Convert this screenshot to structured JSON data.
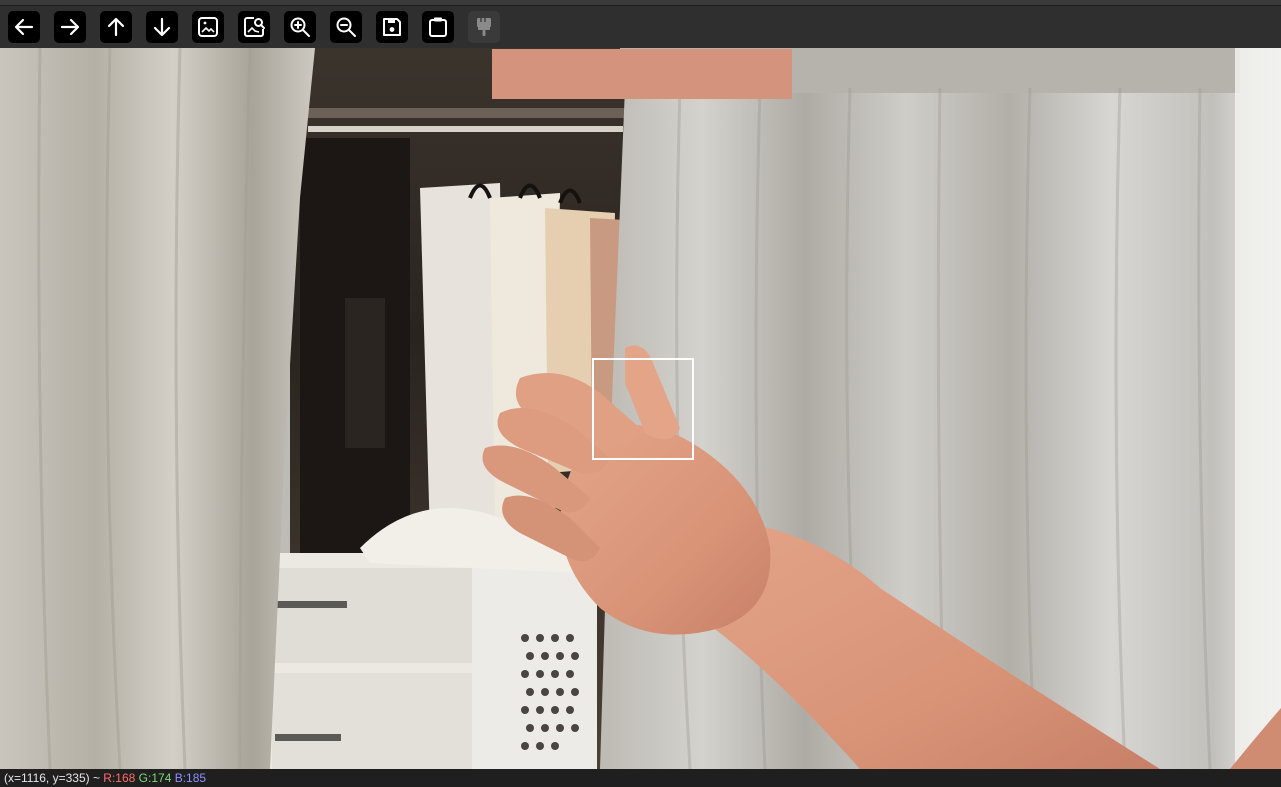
{
  "toolbar": {
    "buttons": [
      {
        "name": "pan-left",
        "icon": "arrow-left-icon",
        "enabled": true
      },
      {
        "name": "pan-right",
        "icon": "arrow-right-icon",
        "enabled": true
      },
      {
        "name": "pan-up",
        "icon": "arrow-up-icon",
        "enabled": true
      },
      {
        "name": "pan-down",
        "icon": "arrow-down-icon",
        "enabled": true
      },
      {
        "name": "zoom-to-fit",
        "icon": "image-icon",
        "enabled": true
      },
      {
        "name": "zoom-original",
        "icon": "image-search-icon",
        "enabled": true
      },
      {
        "name": "zoom-in",
        "icon": "zoom-in-icon",
        "enabled": true
      },
      {
        "name": "zoom-out",
        "icon": "zoom-out-icon",
        "enabled": true
      },
      {
        "name": "save-image",
        "icon": "floppy-disk-icon",
        "enabled": true
      },
      {
        "name": "copy-to-clipboard",
        "icon": "clipboard-icon",
        "enabled": true
      },
      {
        "name": "properties",
        "icon": "paint-brush-icon",
        "enabled": false
      }
    ]
  },
  "overlay": {
    "swatch_color": "#d3937c",
    "roi_color": "#ffffff"
  },
  "status": {
    "coords": "(x=1116, y=335) ~",
    "r": "R:168",
    "g": "G:174",
    "b": "B:185"
  }
}
